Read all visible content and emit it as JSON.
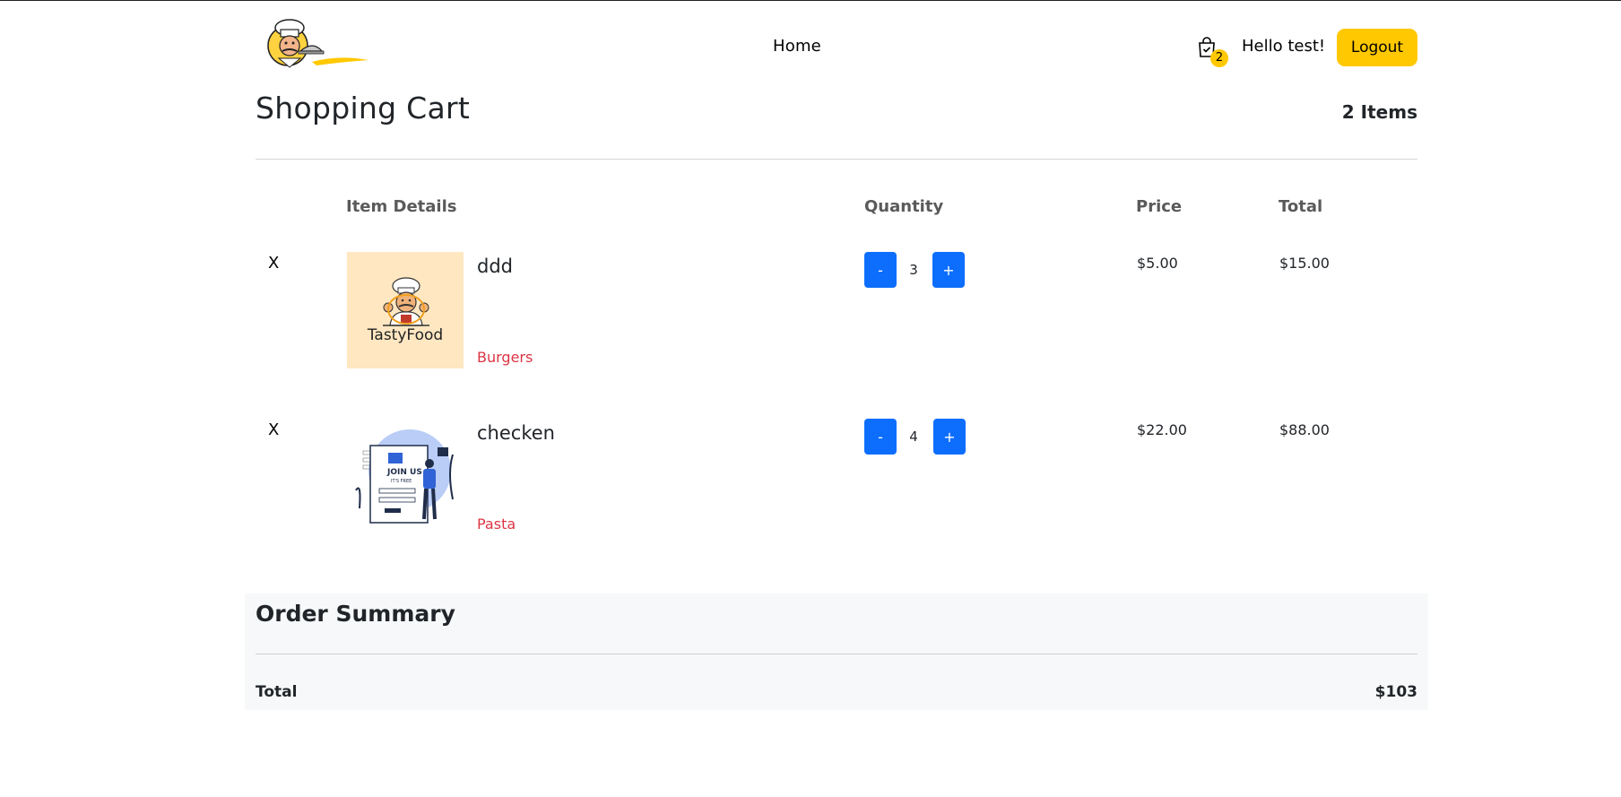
{
  "nav": {
    "home_label": "Home",
    "cart_count": "2",
    "greeting": "Hello test!",
    "logout_label": "Logout"
  },
  "cart": {
    "title": "Shopping Cart",
    "items_count": "2 Items",
    "columns": {
      "details": "Item Details",
      "quantity": "Quantity",
      "price": "Price",
      "total": "Total"
    },
    "items": [
      {
        "remove_label": "X",
        "name": "ddd",
        "category": "Burgers",
        "image_text": "TastyFood",
        "decrement_label": "-",
        "quantity": "3",
        "increment_label": "+",
        "price": "$5.00",
        "total": "$15.00"
      },
      {
        "remove_label": "X",
        "name": "checken",
        "category": "Pasta",
        "image_text": "JOIN US",
        "image_subtext": "IT'S FREE",
        "decrement_label": "-",
        "quantity": "4",
        "increment_label": "+",
        "price": "$22.00",
        "total": "$88.00"
      }
    ]
  },
  "summary": {
    "title": "Order Summary",
    "total_label": "Total",
    "total_value": "$103"
  },
  "colors": {
    "brand_yellow": "#ffc800",
    "button_blue": "#0d6efd",
    "category_red": "#dc3545",
    "summary_bg": "#f7f8f9"
  }
}
